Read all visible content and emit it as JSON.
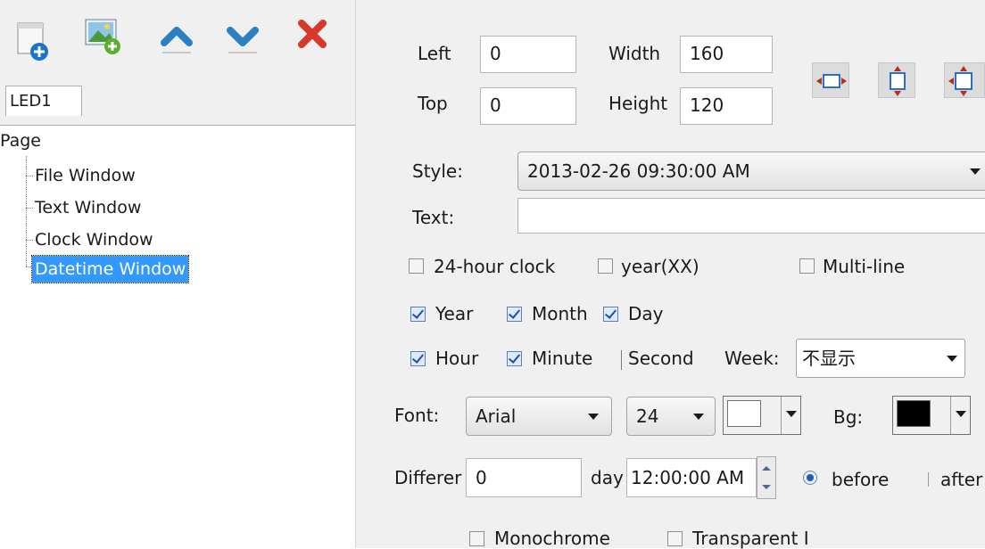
{
  "toolbar": {
    "icons": [
      "new-window-icon",
      "add-picture-icon",
      "move-up-icon",
      "move-down-icon",
      "delete-icon"
    ]
  },
  "screen_tab": "LED1",
  "tree": {
    "root": "Page",
    "items": [
      "File Window",
      "Text Window",
      "Clock Window",
      "Datetime Window"
    ],
    "selected": "Datetime Window"
  },
  "position": {
    "left_label": "Left",
    "left_value": "0",
    "top_label": "Top",
    "top_value": "0",
    "width_label": "Width",
    "width_value": "160",
    "height_label": "Height",
    "height_value": "120"
  },
  "style": {
    "label": "Style:",
    "value": "2013-02-26 09:30:00 AM"
  },
  "text": {
    "label": "Text:",
    "value": ""
  },
  "options": {
    "clock24": {
      "label": "24-hour clock",
      "checked": false
    },
    "year_xx": {
      "label": "year(XX)",
      "checked": false
    },
    "multiline": {
      "label": "Multi-line",
      "checked": false
    },
    "year": {
      "label": "Year",
      "checked": true
    },
    "month": {
      "label": "Month",
      "checked": true
    },
    "day": {
      "label": "Day",
      "checked": true
    },
    "hour": {
      "label": "Hour",
      "checked": true
    },
    "minute": {
      "label": "Minute",
      "checked": true
    },
    "second": {
      "label": "Second"
    }
  },
  "week": {
    "label": "Week:",
    "value": "不显示"
  },
  "font": {
    "label": "Font:",
    "family": "Arial",
    "size": "24",
    "color": "#ffffff",
    "bg_label": "Bg:",
    "bg_color": "#000000"
  },
  "difference": {
    "label": "Differer",
    "value": "0",
    "day_label": "day",
    "time_value": "12:00:00 AM",
    "before_label": "before",
    "after_label": "after",
    "selected": "before"
  },
  "bottom": {
    "monochrome": {
      "label": "Monochrome",
      "checked": false
    },
    "transparent": {
      "label": "Transparent I",
      "checked": false
    }
  }
}
